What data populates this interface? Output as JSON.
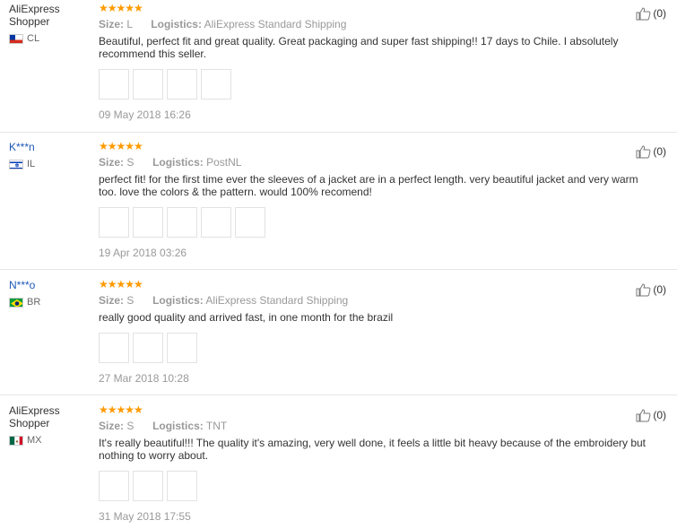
{
  "reviews": [
    {
      "user": "AliExpress Shopper",
      "masked": false,
      "country": "CL",
      "stars": "★★★★★",
      "size_label": "Size:",
      "size": "L",
      "logistics_label": "Logistics:",
      "logistics": "AliExpress Standard Shipping",
      "text": "Beautiful, perfect fit and great quality. Great packaging and super fast shipping!! 17 days to Chile. I absolutely recommend this seller.",
      "images": 4,
      "date": "09 May 2018 16:26",
      "helpful": "(0)"
    },
    {
      "user": "K***n",
      "masked": true,
      "country": "IL",
      "stars": "★★★★★",
      "size_label": "Size:",
      "size": "S",
      "logistics_label": "Logistics:",
      "logistics": "PostNL",
      "text": "perfect fit! for the first time ever the sleeves of a jacket are in a perfect length. very beautiful jacket and very warm too. love the colors & the pattern. would 100% recomend!",
      "images": 5,
      "date": "19 Apr 2018 03:26",
      "helpful": "(0)"
    },
    {
      "user": "N***o",
      "masked": true,
      "country": "BR",
      "stars": "★★★★★",
      "size_label": "Size:",
      "size": "S",
      "logistics_label": "Logistics:",
      "logistics": "AliExpress Standard Shipping",
      "text": "really good quality and arrived fast, in one month for the brazil",
      "images": 3,
      "date": "27 Mar 2018 10:28",
      "helpful": "(0)"
    },
    {
      "user": "AliExpress Shopper",
      "masked": false,
      "country": "MX",
      "stars": "★★★★★",
      "size_label": "Size:",
      "size": "S",
      "logistics_label": "Logistics:",
      "logistics": "TNT",
      "text": "It's really beautiful!!! The quality it's amazing, very well done, it feels a little bit heavy because of the embroidery but nothing to worry about.",
      "images": 3,
      "date": "31 May 2018 17:55",
      "helpful": "(0)"
    }
  ],
  "colors": {
    "star": "#ff9a00",
    "masked_name": "#1c58b7",
    "meta": "#999999",
    "divider": "#e6e6e6"
  },
  "icons": {
    "helpful": "thumbs-up-icon"
  }
}
